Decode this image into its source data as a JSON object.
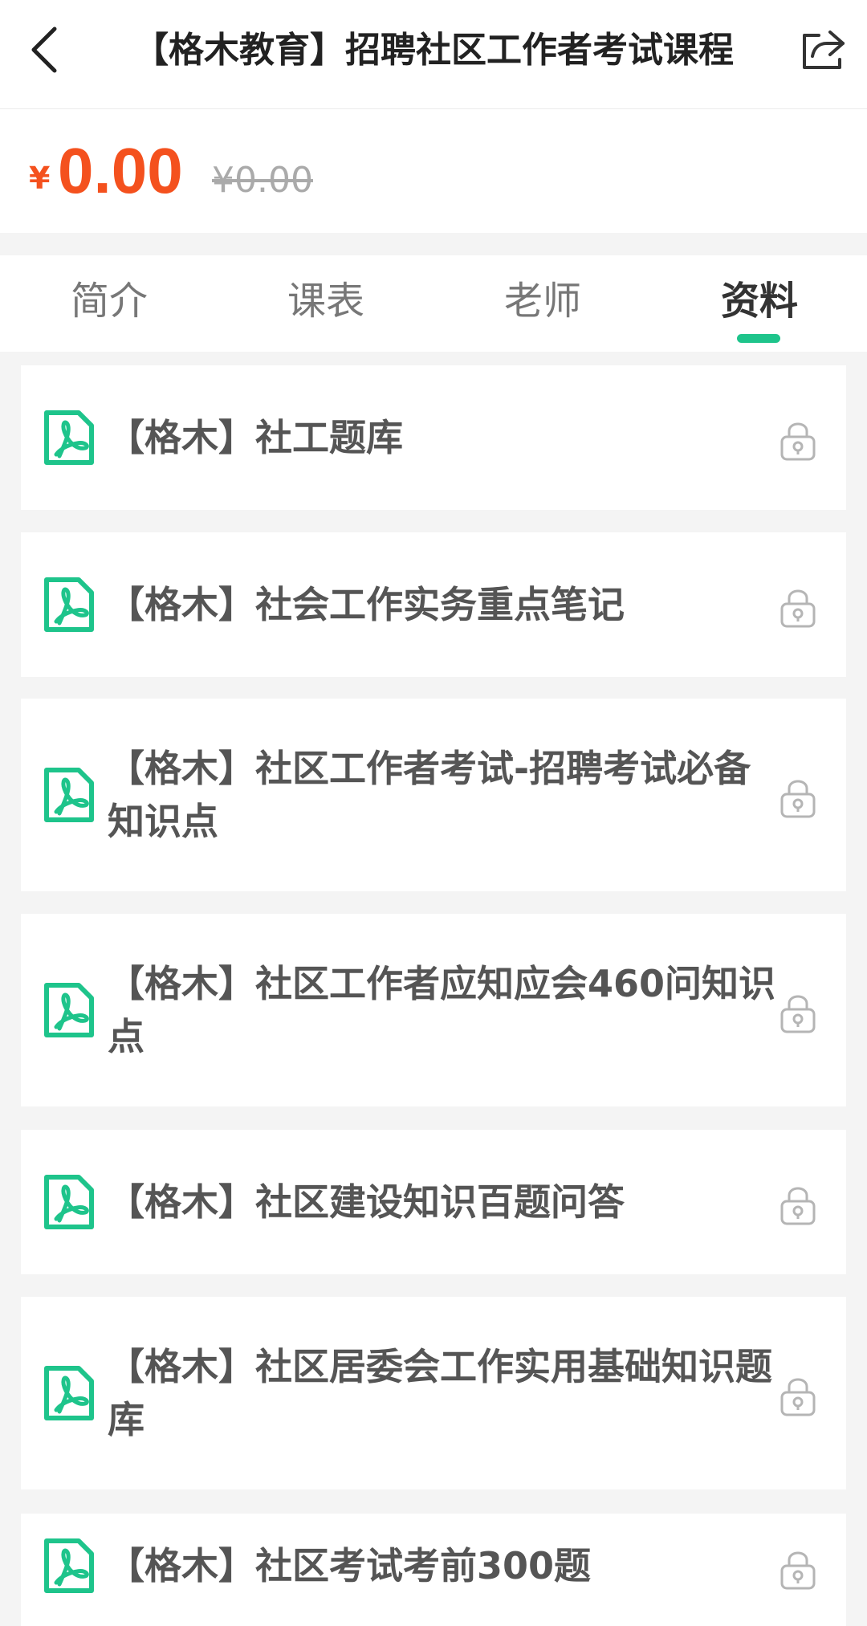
{
  "header": {
    "title": "【格木教育】招聘社区工作者考试课程"
  },
  "price": {
    "currency": "¥",
    "current": "0.00",
    "original": "¥0.00"
  },
  "tabs": [
    {
      "label": "简介"
    },
    {
      "label": "课表"
    },
    {
      "label": "老师"
    },
    {
      "label": "资料"
    }
  ],
  "active_tab": "资料",
  "materials": [
    {
      "title": "【格木】社工题库"
    },
    {
      "title": "【格木】社会工作实务重点笔记"
    },
    {
      "title": "【格木】社区工作者考试-招聘考试必备知识点"
    },
    {
      "title": "【格木】社区工作者应知应会460问知识点"
    },
    {
      "title": "【格木】社区建设知识百题问答"
    },
    {
      "title": "【格木】社区居委会工作实用基础知识题库"
    },
    {
      "title": "【格木】社区考试考前300题"
    }
  ],
  "colors": {
    "accent": "#1ec48b",
    "price": "#f4511e"
  },
  "icons": {
    "back": "chevron-left-icon",
    "share": "share-icon",
    "file": "pdf-icon",
    "locked": "lock-icon"
  }
}
